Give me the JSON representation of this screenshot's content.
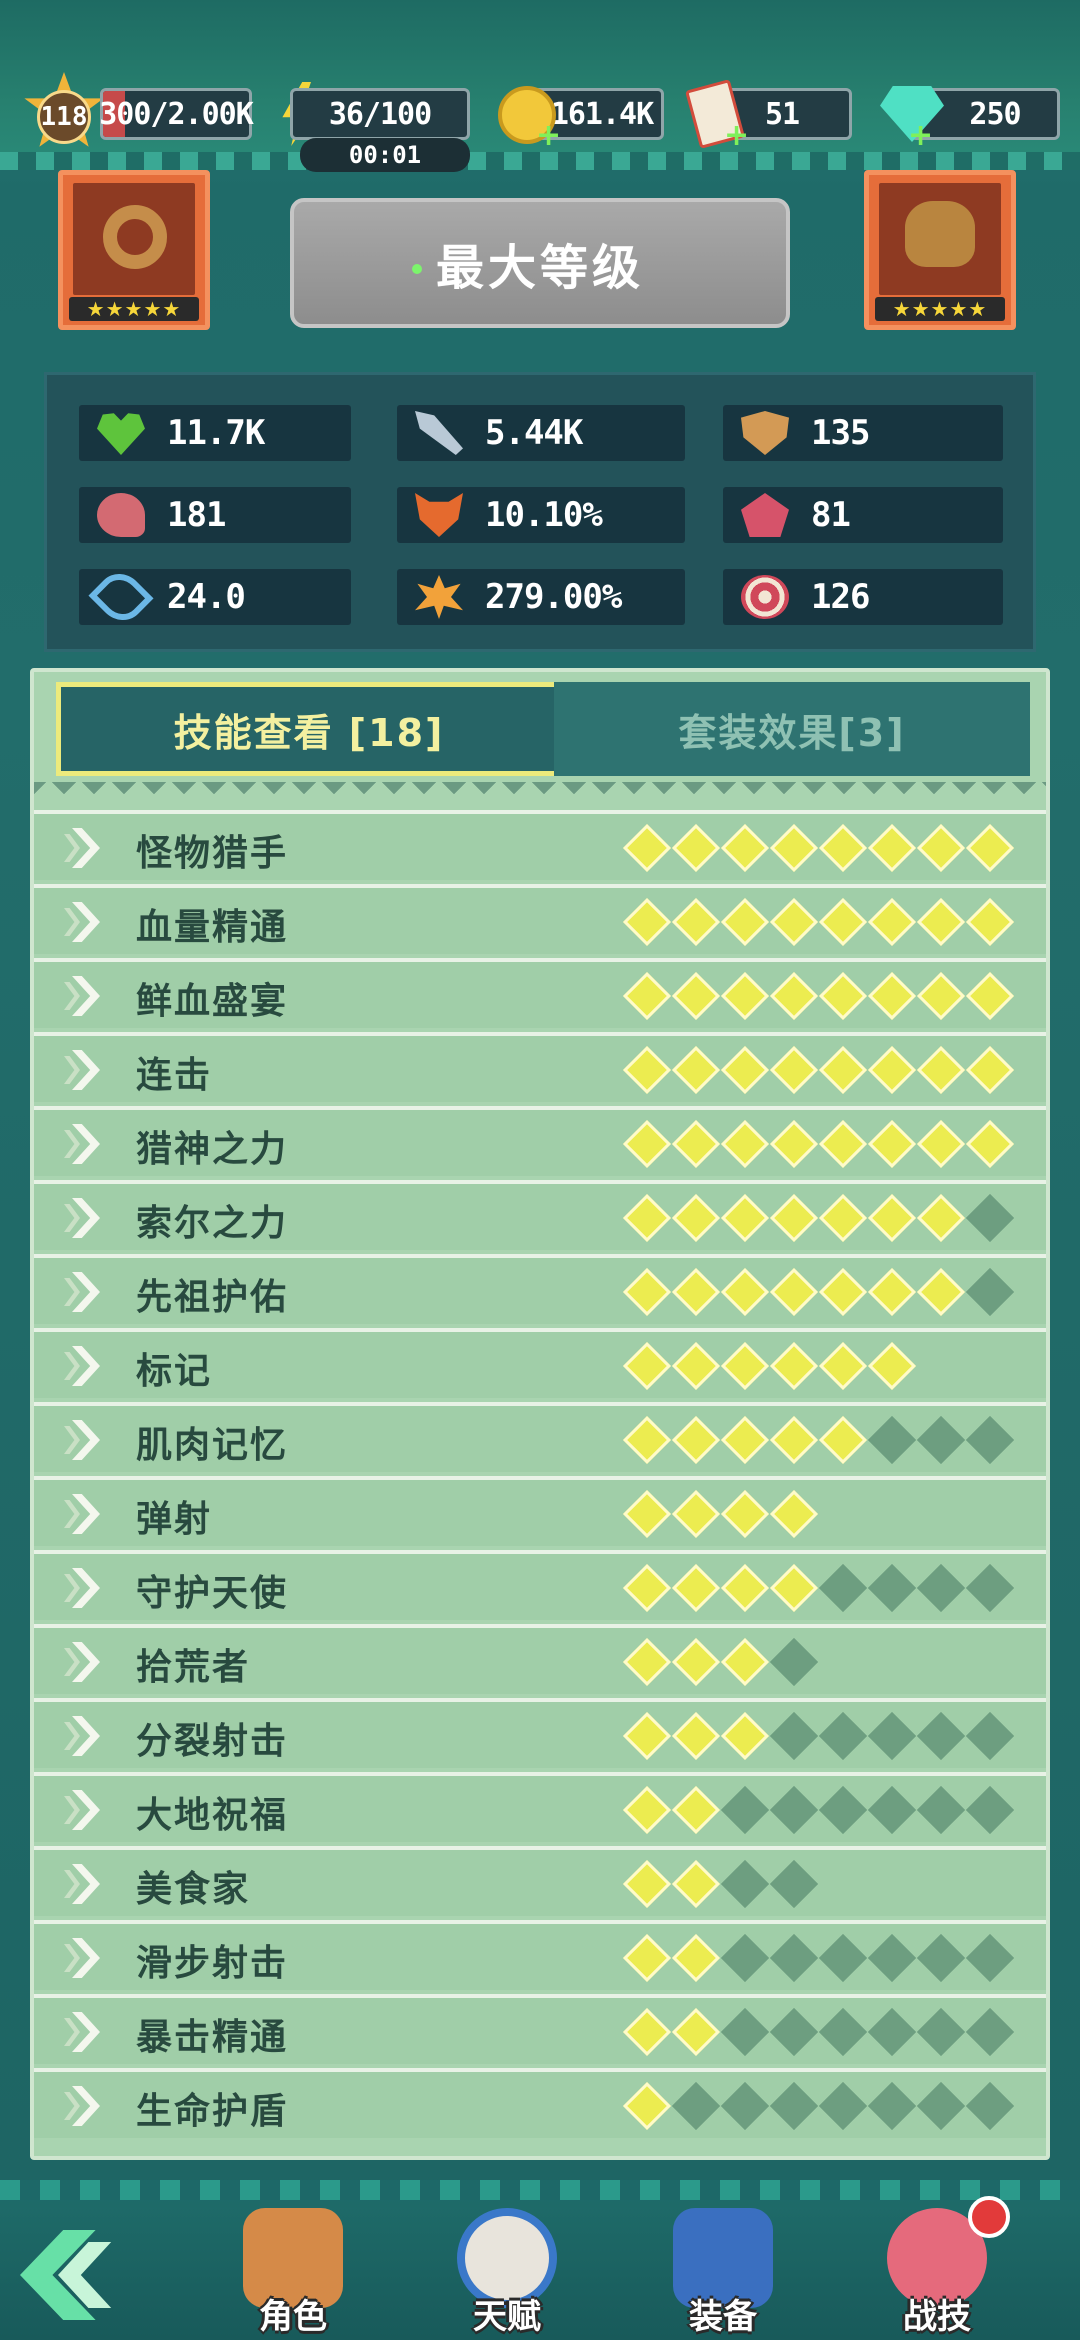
{
  "resources": {
    "level": "118",
    "xp": "300/2.00K",
    "xp_progress": 0.15,
    "energy": "36/100",
    "energy_timer": "00:01",
    "coins": "161.4K",
    "tickets": "51",
    "gems": "250"
  },
  "header": {
    "title": "最大等级",
    "left_item_stars": "★★★★★",
    "right_item_stars": "★★★★★"
  },
  "stats": [
    {
      "icon": "heart-icon",
      "value": "11.7K"
    },
    {
      "icon": "spear-icon",
      "value": "5.44K"
    },
    {
      "icon": "shield-icon",
      "value": "135"
    },
    {
      "icon": "meat-icon",
      "value": "181"
    },
    {
      "icon": "fox-icon",
      "value": "10.10%"
    },
    {
      "icon": "crown-badge-icon",
      "value": "81"
    },
    {
      "icon": "bow-icon",
      "value": "24.0"
    },
    {
      "icon": "crit-burst-icon",
      "value": "279.00%"
    },
    {
      "icon": "target-icon",
      "value": "126"
    }
  ],
  "tabs": {
    "skills": "技能查看 [18]",
    "sets": "套装效果[3]"
  },
  "skills": [
    {
      "name": "怪物猎手",
      "on": 8,
      "off": 0
    },
    {
      "name": "血量精通",
      "on": 8,
      "off": 0
    },
    {
      "name": "鲜血盛宴",
      "on": 8,
      "off": 0
    },
    {
      "name": "连击",
      "on": 8,
      "off": 0
    },
    {
      "name": "猎神之力",
      "on": 8,
      "off": 0
    },
    {
      "name": "索尔之力",
      "on": 7,
      "off": 1
    },
    {
      "name": "先祖护佑",
      "on": 7,
      "off": 1
    },
    {
      "name": "标记",
      "on": 6,
      "off": 0
    },
    {
      "name": "肌肉记忆",
      "on": 5,
      "off": 3
    },
    {
      "name": "弹射",
      "on": 4,
      "off": 0
    },
    {
      "name": "守护天使",
      "on": 4,
      "off": 4
    },
    {
      "name": "拾荒者",
      "on": 3,
      "off": 1
    },
    {
      "name": "分裂射击",
      "on": 3,
      "off": 5
    },
    {
      "name": "大地祝福",
      "on": 2,
      "off": 6
    },
    {
      "name": "美食家",
      "on": 2,
      "off": 2
    },
    {
      "name": "滑步射击",
      "on": 2,
      "off": 6
    },
    {
      "name": "暴击精通",
      "on": 2,
      "off": 6
    },
    {
      "name": "生命护盾",
      "on": 1,
      "off": 7
    }
  ],
  "nav": {
    "character": "角色",
    "talent": "天赋",
    "equipment": "装备",
    "battle_skill": "战技"
  },
  "colors": {
    "accent": "#ecec50",
    "panel": "#a9d4b0",
    "xp_bar": "#c64a4a"
  }
}
